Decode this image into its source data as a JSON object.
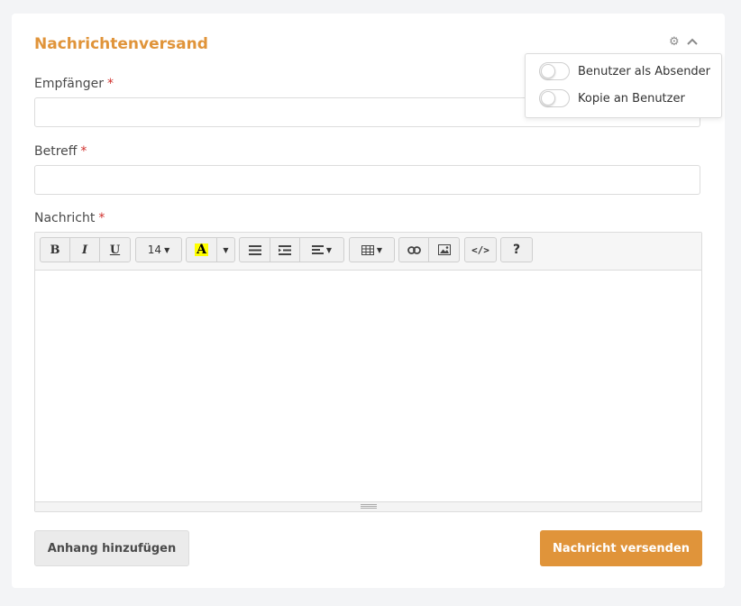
{
  "panel": {
    "title": "Nachrichtenversand",
    "icons": [
      "gear-icon",
      "chevron-up-icon"
    ]
  },
  "fields": {
    "recipient": {
      "label": "Empfänger",
      "required_mark": "*",
      "value": "",
      "placeholder": ""
    },
    "subject": {
      "label": "Betreff",
      "required_mark": "*",
      "value": "",
      "placeholder": ""
    },
    "message": {
      "label": "Nachricht",
      "required_mark": "*",
      "value": ""
    }
  },
  "toolbar": {
    "bold": "B",
    "italic": "I",
    "underline": "U",
    "font_size": "14",
    "highlight_letter": "A",
    "highlight_color": "#ffff00",
    "help": "?",
    "code": "</>"
  },
  "settings_popover": {
    "options": [
      {
        "label": "Benutzer als Absender",
        "enabled": false
      },
      {
        "label": "Kopie an Benutzer",
        "enabled": false
      }
    ]
  },
  "actions": {
    "attach_label": "Anhang hinzufügen",
    "send_label": "Nachricht versenden"
  },
  "colors": {
    "accent": "#e0943a",
    "required": "#d0312d",
    "background": "#f3f4f6"
  }
}
